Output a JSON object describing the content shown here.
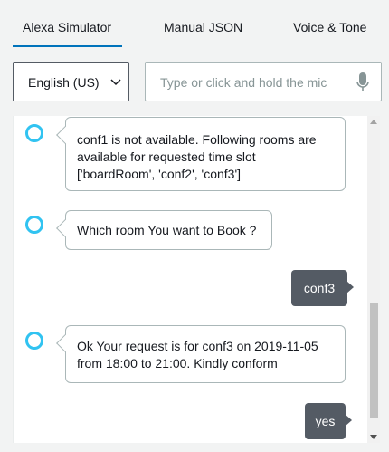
{
  "tabs": [
    {
      "label": "Alexa Simulator",
      "active": true
    },
    {
      "label": "Manual JSON",
      "active": false
    },
    {
      "label": "Voice & Tone",
      "active": false
    }
  ],
  "locale_select": {
    "value": "English (US)"
  },
  "utterance_input": {
    "placeholder": "Type or click and hold the mic",
    "value": ""
  },
  "colors": {
    "accent": "#0073bb",
    "alexa_ring": "#31c3f1",
    "user_bubble": "#545b64"
  },
  "messages": [
    {
      "from": "alexa",
      "lines": [
        "conf1 is not available. Following rooms are",
        "available for requested time slot",
        "['boardRoom', 'conf2', 'conf3']"
      ]
    },
    {
      "from": "alexa",
      "lines": [
        "Which room You want to Book ?"
      ]
    },
    {
      "from": "user",
      "text": "conf3"
    },
    {
      "from": "alexa",
      "lines": [
        "Ok Your request is for conf3 on 2019-11-05",
        "from 18:00 to 21:00. Kindly conform"
      ]
    },
    {
      "from": "user",
      "text": "yes"
    }
  ]
}
